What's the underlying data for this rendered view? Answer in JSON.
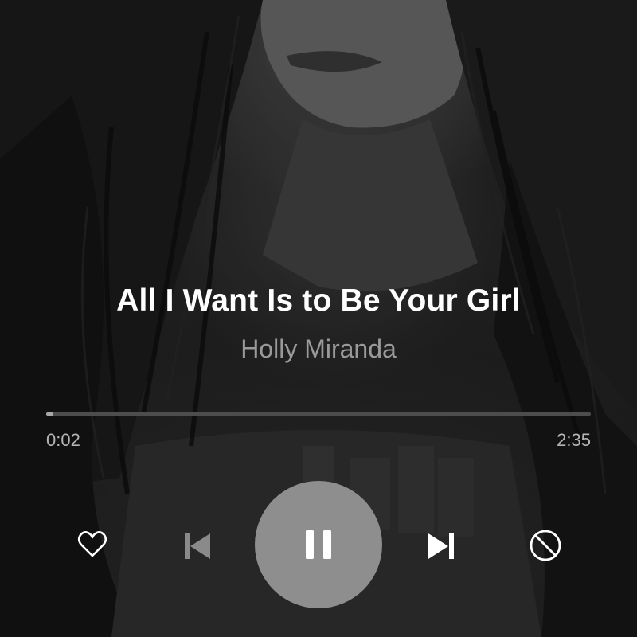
{
  "now_playing": {
    "track_title": "All I Want Is to Be Your Girl",
    "artist_name": "Holly Miranda"
  },
  "playback": {
    "elapsed": "0:02",
    "duration": "2:35",
    "progress_fraction": 0.013,
    "state": "playing"
  },
  "controls": {
    "like_icon": "heart-outline-icon",
    "previous_icon": "skip-previous-icon",
    "pause_icon": "pause-icon",
    "next_icon": "skip-next-icon",
    "ban_icon": "block-icon"
  },
  "colors": {
    "title": "#ffffff",
    "artist": "#9a9a9a",
    "progress_track": "#4d4d4d",
    "progress_fill": "#a8a8a8",
    "play_button": "#8e8e8e",
    "icon_active": "#ffffff",
    "icon_disabled": "#8a8a8a"
  }
}
